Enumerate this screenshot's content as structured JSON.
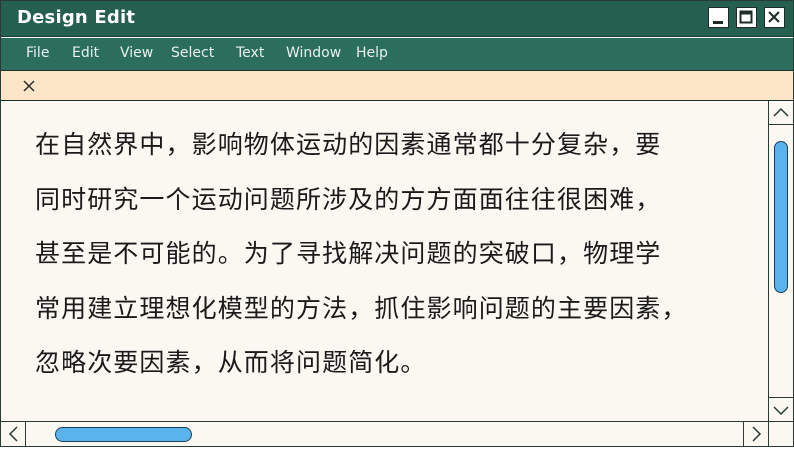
{
  "window": {
    "title": "Design Edit",
    "controls": [
      "minimize-icon",
      "maximize-icon",
      "close-icon"
    ]
  },
  "menu": {
    "items": [
      "File",
      "Edit",
      "View",
      "Select",
      "Text",
      "Window",
      "Help"
    ]
  },
  "tab": {
    "close_icon": "close-icon"
  },
  "content": {
    "lines": [
      "在自然界中，影响物体运动的因素通常都十分复杂，要",
      "同时研究一个运动问题所涉及的方方面面往往很困难，",
      "甚至是不可能的。为了寻找解决问题的突破口，物理学",
      "常用建立理想化模型的方法，抓住影响问题的主要因素，",
      "忽略次要因素，从而将问题简化。"
    ]
  },
  "scrollbars": {
    "vertical_arrows": [
      "chevron-up-icon",
      "chevron-down-icon"
    ],
    "horizontal_arrows": [
      "chevron-left-icon",
      "chevron-right-icon"
    ]
  },
  "colors": {
    "titlebar": "#245f4f",
    "menubar": "#2b6e5e",
    "tabstrip": "#fde6c8",
    "background": "#fbf8f2",
    "scroll_thumb": "#58b4ea"
  }
}
